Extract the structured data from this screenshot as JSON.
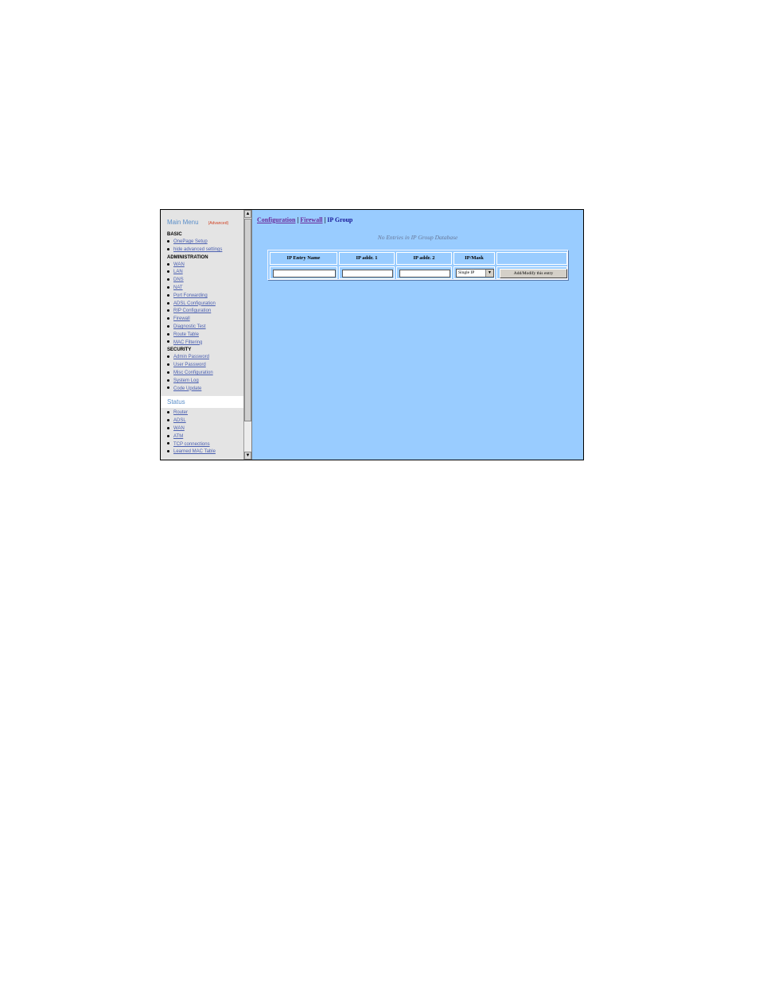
{
  "sidebar": {
    "title": "Main Menu",
    "advanced_tag": "(Advanced)",
    "basic_label": "BASIC",
    "basic_items": [
      {
        "label": "OnePage Setup"
      },
      {
        "label": "hide advanced settings"
      }
    ],
    "admin_label": "ADMINISTRATION",
    "admin_items": [
      {
        "label": "WAN"
      },
      {
        "label": "LAN"
      },
      {
        "label": "DNS"
      },
      {
        "label": "NAT"
      },
      {
        "label": "Port Forwarding"
      },
      {
        "label": "ADSL Configuration"
      },
      {
        "label": "RIP Configuration"
      },
      {
        "label": "Firewall"
      },
      {
        "label": "Diagnostic Test"
      },
      {
        "label": "Route Table"
      },
      {
        "label": "MAC Filtering"
      }
    ],
    "security_label": "SECURITY",
    "security_items": [
      {
        "label": "Admin Password"
      },
      {
        "label": "User Password"
      },
      {
        "label": "Misc Configuration"
      },
      {
        "label": "System Log"
      },
      {
        "label": "Code Update"
      }
    ],
    "status_label": "Status",
    "status_items": [
      {
        "label": "Router"
      },
      {
        "label": "ADSL"
      },
      {
        "label": "WAN"
      },
      {
        "label": "ATM"
      },
      {
        "label": "TCP connections"
      },
      {
        "label": "Learned MAC Table"
      }
    ]
  },
  "breadcrumb": {
    "configuration": "Configuration",
    "sep1": " | ",
    "firewall": "Firewall",
    "sep2": " | ",
    "current": "IP Group"
  },
  "main": {
    "empty_message": "No Entries in IP Group Database",
    "table": {
      "headers": [
        "IP Entry Name",
        "IP addr. 1",
        "IP addr. 2",
        "IP/Mask",
        ""
      ],
      "entry_name_value": "",
      "ip1_value": "",
      "ip2_value": "",
      "mask_selected": "Single IP",
      "add_button_label": "Add/Modify this entry"
    }
  },
  "scrollbar": {
    "up_icon": "up-arrow-icon",
    "down_icon": "down-arrow-icon"
  }
}
